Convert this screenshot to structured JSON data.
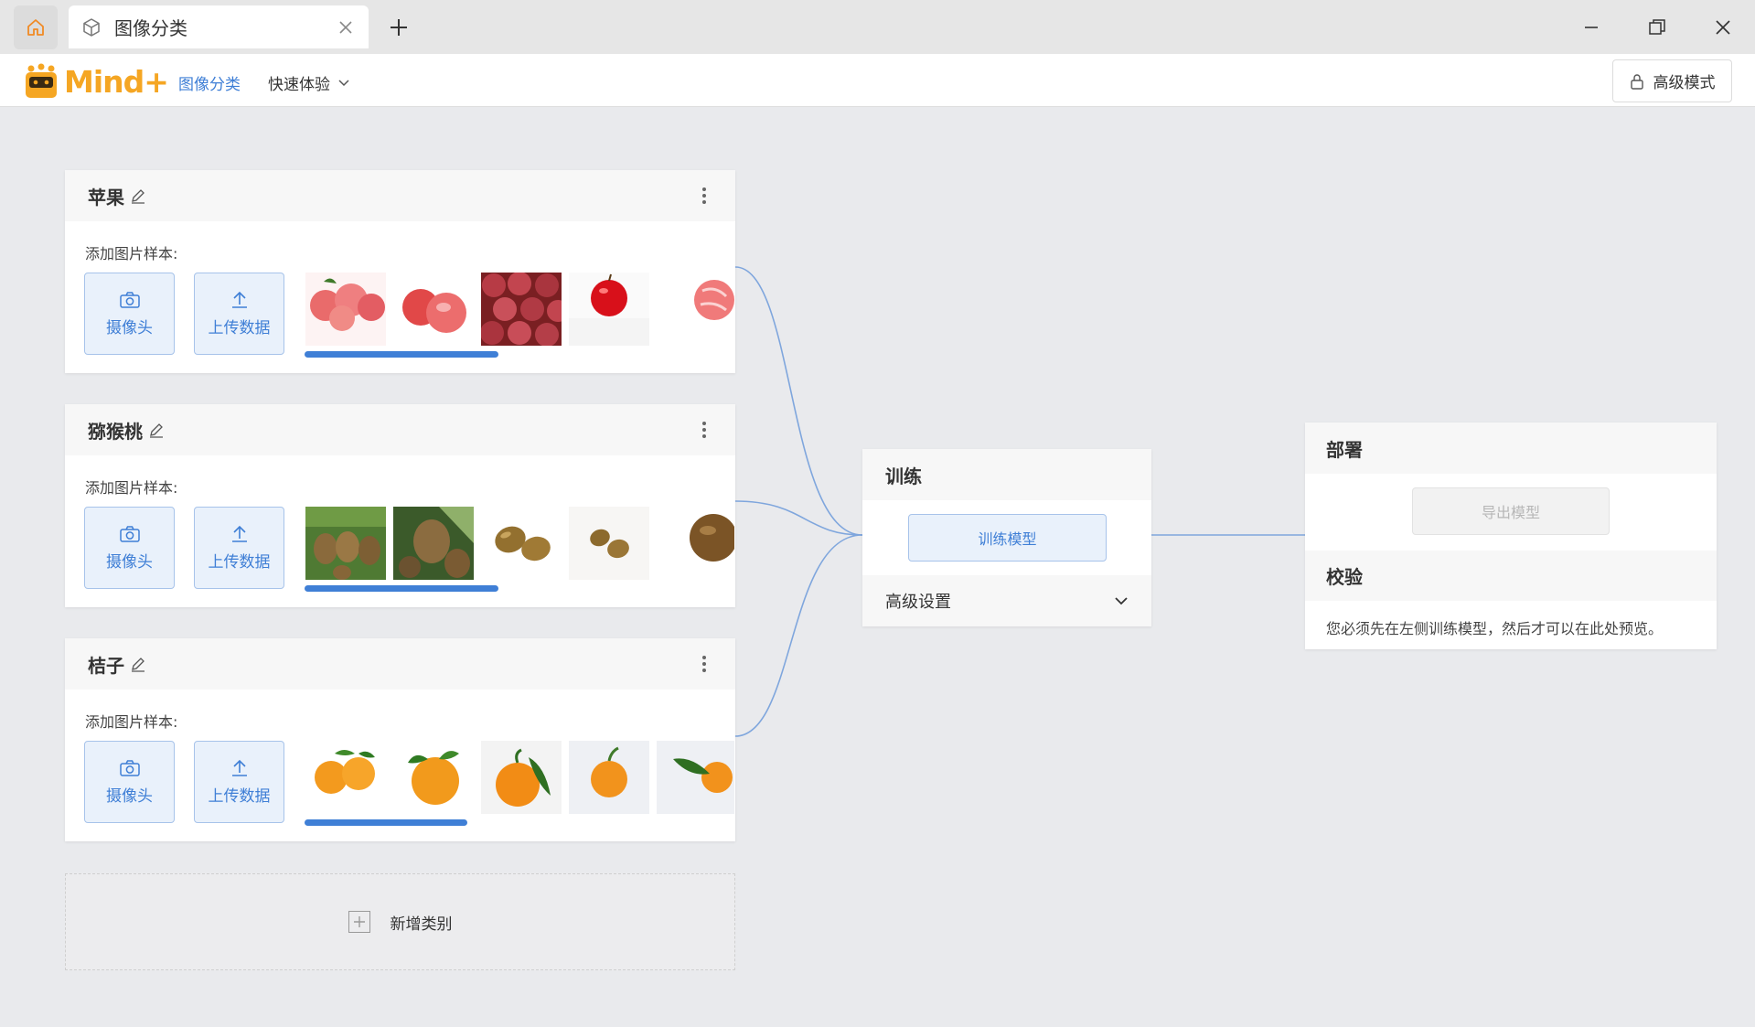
{
  "tab": {
    "title": "图像分类"
  },
  "header": {
    "logo_text": "Mind+",
    "nav_current": "图像分类",
    "nav_quick": "快速体验",
    "advanced_mode": "高级模式"
  },
  "classes": [
    {
      "name": "苹果",
      "add_label": "添加图片样本:",
      "camera_label": "摄像头",
      "upload_label": "上传数据",
      "samples_fill": 0.47
    },
    {
      "name": "猕猴桃",
      "add_label": "添加图片样本:",
      "camera_label": "摄像头",
      "upload_label": "上传数据",
      "samples_fill": 0.47
    },
    {
      "name": "桔子",
      "add_label": "添加图片样本:",
      "camera_label": "摄像头",
      "upload_label": "上传数据",
      "samples_fill": 0.39
    }
  ],
  "add_class_label": "新增类别",
  "train": {
    "title": "训练",
    "button": "训练模型",
    "advanced": "高级设置"
  },
  "deploy": {
    "title": "部署",
    "export_button": "导出模型"
  },
  "verify": {
    "title": "校验",
    "note": "您必须先在左侧训练模型，然后才可以在此处预览。"
  },
  "colors": {
    "accent": "#3f7fd6",
    "logo": "#f5a623",
    "background": "#e9eaed"
  }
}
